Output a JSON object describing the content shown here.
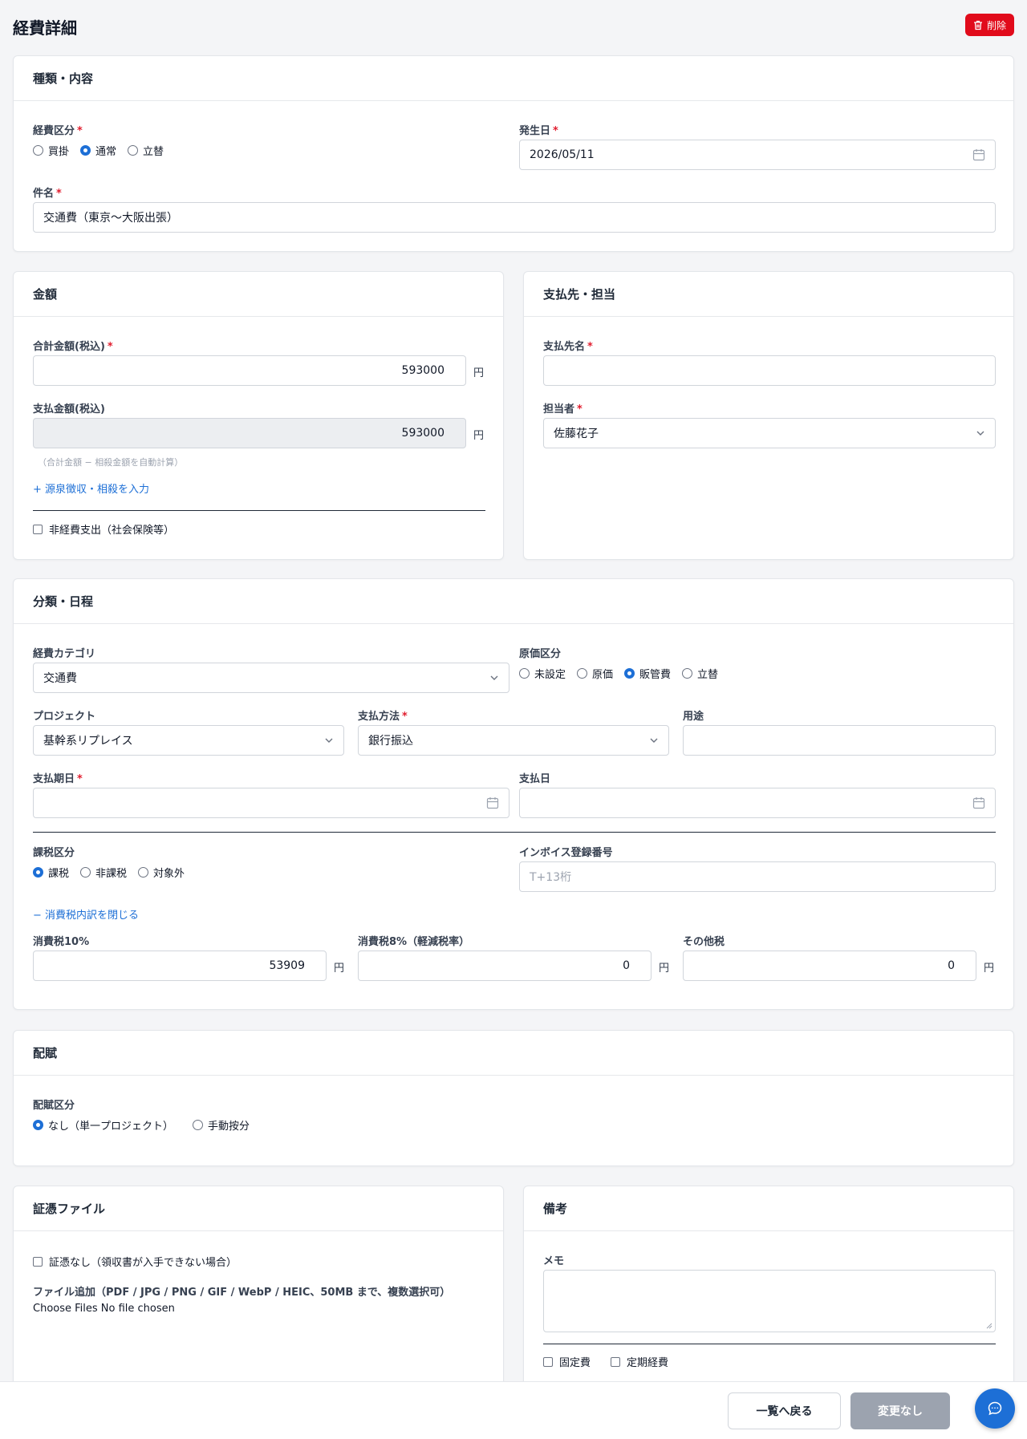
{
  "page": {
    "title": "経費詳細",
    "delete_label": "削除"
  },
  "required_mark": "*",
  "sections": {
    "kind": {
      "title": "種類・内容",
      "expense_type_label": "経費区分",
      "expense_type_options": [
        "買掛",
        "通常",
        "立替"
      ],
      "expense_type_selected": "通常",
      "date_label": "発生日",
      "date_value": "2026/05/11",
      "subject_label": "件名",
      "subject_value": "交通費（東京〜大阪出張）"
    },
    "amount": {
      "title": "金額",
      "total_label": "合計金額(税込)",
      "total_value": "593000",
      "pay_label": "支払金額(税込)",
      "pay_value": "593000",
      "yen": "円",
      "pay_hint": "（合計金額 − 相殺金額を自動計算）",
      "withholding_link": "+ 源泉徴収・相殺を入力",
      "non_expense_label": "非経費支出（社会保険等）"
    },
    "payee": {
      "title": "支払先・担当",
      "payee_label": "支払先名",
      "payee_value": "",
      "person_label": "担当者",
      "person_value": "佐藤花子"
    },
    "classification": {
      "title": "分類・日程",
      "category_label": "経費カテゴリ",
      "category_value": "交通費",
      "cost_type_label": "原価区分",
      "cost_type_options": [
        "未設定",
        "原価",
        "販管費",
        "立替"
      ],
      "cost_type_selected": "販管費",
      "project_label": "プロジェクト",
      "project_value": "基幹系リプレイス",
      "method_label": "支払方法",
      "method_value": "銀行振込",
      "purpose_label": "用途",
      "purpose_value": "",
      "due_label": "支払期日",
      "due_value": "",
      "paydate_label": "支払日",
      "paydate_value": "",
      "tax_type_label": "課税区分",
      "tax_type_options": [
        "課税",
        "非課税",
        "対象外"
      ],
      "tax_type_selected": "課税",
      "invoice_label": "インボイス登録番号",
      "invoice_placeholder": "T+13桁",
      "tax_toggle_link": "− 消費税内訳を閉じる",
      "tax10_label": "消費税10%",
      "tax10_value": "53909",
      "tax8_label": "消費税8%（軽減税率）",
      "tax8_value": "0",
      "tax_other_label": "その他税",
      "tax_other_value": "0",
      "yen": "円"
    },
    "allocation": {
      "title": "配賦",
      "type_label": "配賦区分",
      "options": [
        "なし（単一プロジェクト）",
        "手動按分"
      ],
      "selected": "なし（単一プロジェクト）"
    },
    "evidence": {
      "title": "証憑ファイル",
      "no_evidence_label": "証憑なし（領収書が入手できない場合）",
      "add_file_label": "ファイル追加（PDF / JPG / PNG / GIF / WebP / HEIC、50MB まで、複数選択可）",
      "choose_files": "Choose Files",
      "no_file": "No file chosen"
    },
    "notes": {
      "title": "備考",
      "memo_label": "メモ",
      "memo_value": "",
      "fixed_label": "固定費",
      "recurring_label": "定期経費"
    }
  },
  "footer": {
    "back_label": "一覧へ戻る",
    "no_change_label": "変更なし"
  },
  "colors": {
    "primary": "#1d6fd6",
    "danger": "#e10b1b",
    "disabled_button": "#9ca3af"
  },
  "icons": [
    "trash-icon",
    "calendar-icon",
    "chevron-down-icon",
    "chat-icon"
  ]
}
